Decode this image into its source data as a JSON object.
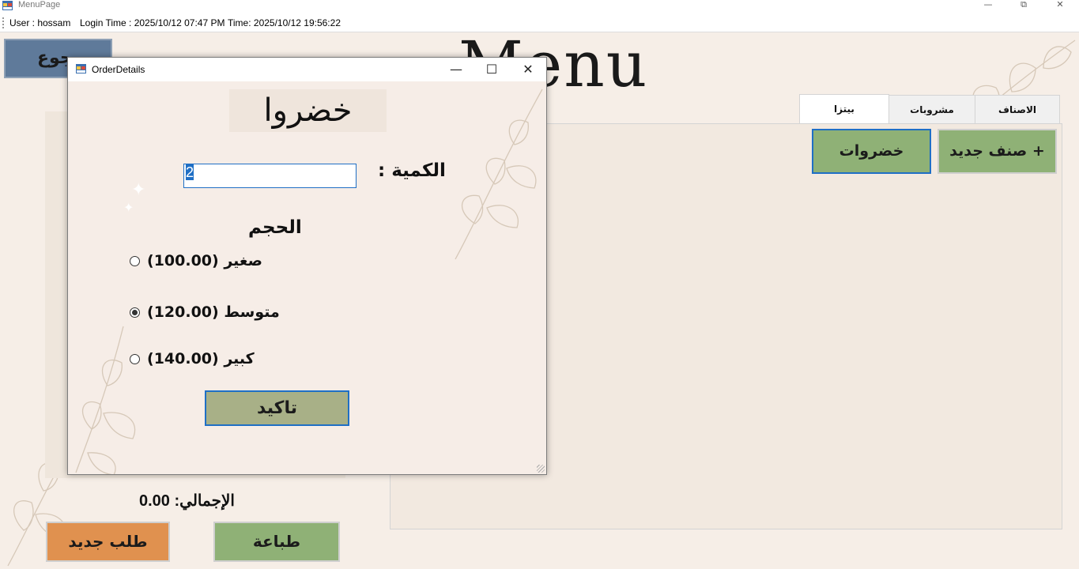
{
  "window": {
    "title": "MenuPage",
    "min_glyph": "—",
    "max_glyph": "⧉",
    "close_glyph": "✕"
  },
  "status": {
    "user": "User : hossam",
    "login_time": "Login Time :  2025/10/12 07:47 PM",
    "time": "Time: 2025/10/12 19:56:22"
  },
  "main": {
    "back_label": "رجوع",
    "menu_title": "Menu",
    "total_label": "الإجمالي: 0.00",
    "new_order_label": "طلب جديد",
    "print_label": "طباعة"
  },
  "tabs": [
    {
      "label": "بيتزا",
      "active": true
    },
    {
      "label": "مشروبات",
      "active": false
    },
    {
      "label": "الاصناف",
      "active": false
    }
  ],
  "categories": {
    "vegetables": "خضروات",
    "new_category": "صنف جديد +"
  },
  "dialog": {
    "title": "OrderDetails",
    "min_glyph": "—",
    "max_glyph": "☐",
    "close_glyph": "✕",
    "item_name": "خضروا",
    "quantity_label": "الكمية :",
    "quantity_value": "2",
    "size_label": "الحجم",
    "sizes": [
      {
        "label": "صغير (100.00)",
        "checked": false
      },
      {
        "label": "متوسط (120.00)",
        "checked": true
      },
      {
        "label": "كبير (140.00)",
        "checked": false
      }
    ],
    "confirm_label": "تاكيد"
  }
}
